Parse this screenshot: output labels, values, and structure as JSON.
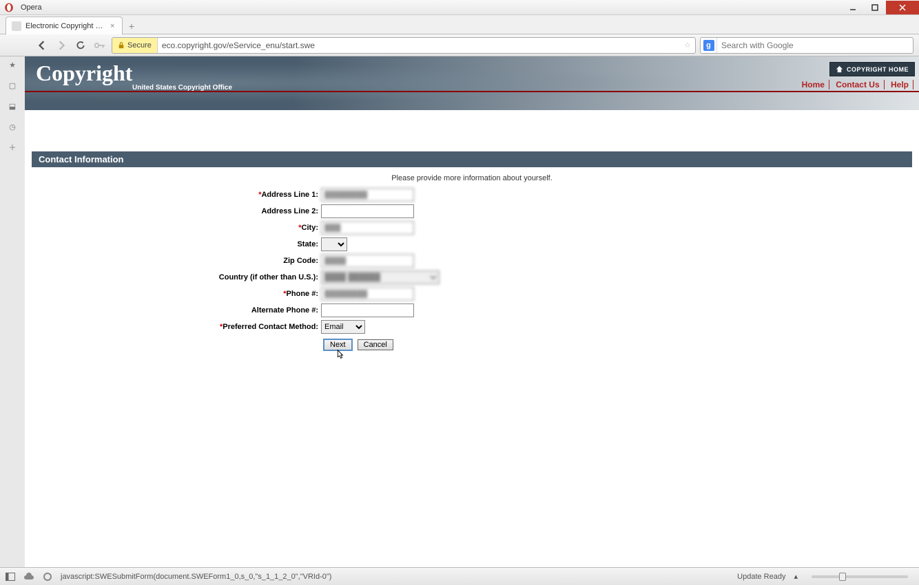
{
  "browser": {
    "name": "Opera",
    "tab_title": "Electronic Copyright O...",
    "secure_label": "Secure",
    "url": "eco.copyright.gov/eService_enu/start.swe",
    "search_placeholder": "Search with Google"
  },
  "header": {
    "logo": "Copyright",
    "subtitle": "United States Copyright Office",
    "home_btn": "COPYRIGHT HOME",
    "links": {
      "home": "Home",
      "contact": "Contact Us",
      "help": "Help"
    }
  },
  "section": {
    "title": "Contact Information",
    "instruction": "Please provide more information about yourself."
  },
  "form": {
    "address1": {
      "label": "Address Line 1:",
      "value": "████████"
    },
    "address2": {
      "label": "Address Line 2:",
      "value": ""
    },
    "city": {
      "label": "City:",
      "value": "███"
    },
    "state": {
      "label": "State:",
      "value": ""
    },
    "zip": {
      "label": "Zip Code:",
      "value": "████"
    },
    "country": {
      "label": "Country  (if other than U.S.):",
      "value": "████ ██████"
    },
    "phone": {
      "label": "Phone #:",
      "value": "████████"
    },
    "alt_phone": {
      "label": "Alternate Phone #:",
      "value": ""
    },
    "contact_method": {
      "label": "Preferred Contact Method:",
      "value": "Email"
    },
    "buttons": {
      "next": "Next",
      "cancel": "Cancel"
    }
  },
  "status": {
    "js_text": "javascript:SWESubmitForm(document.SWEForm1_0,s_0,\"s_1_1_2_0\",\"VRId-0\")",
    "update": "Update Ready"
  }
}
